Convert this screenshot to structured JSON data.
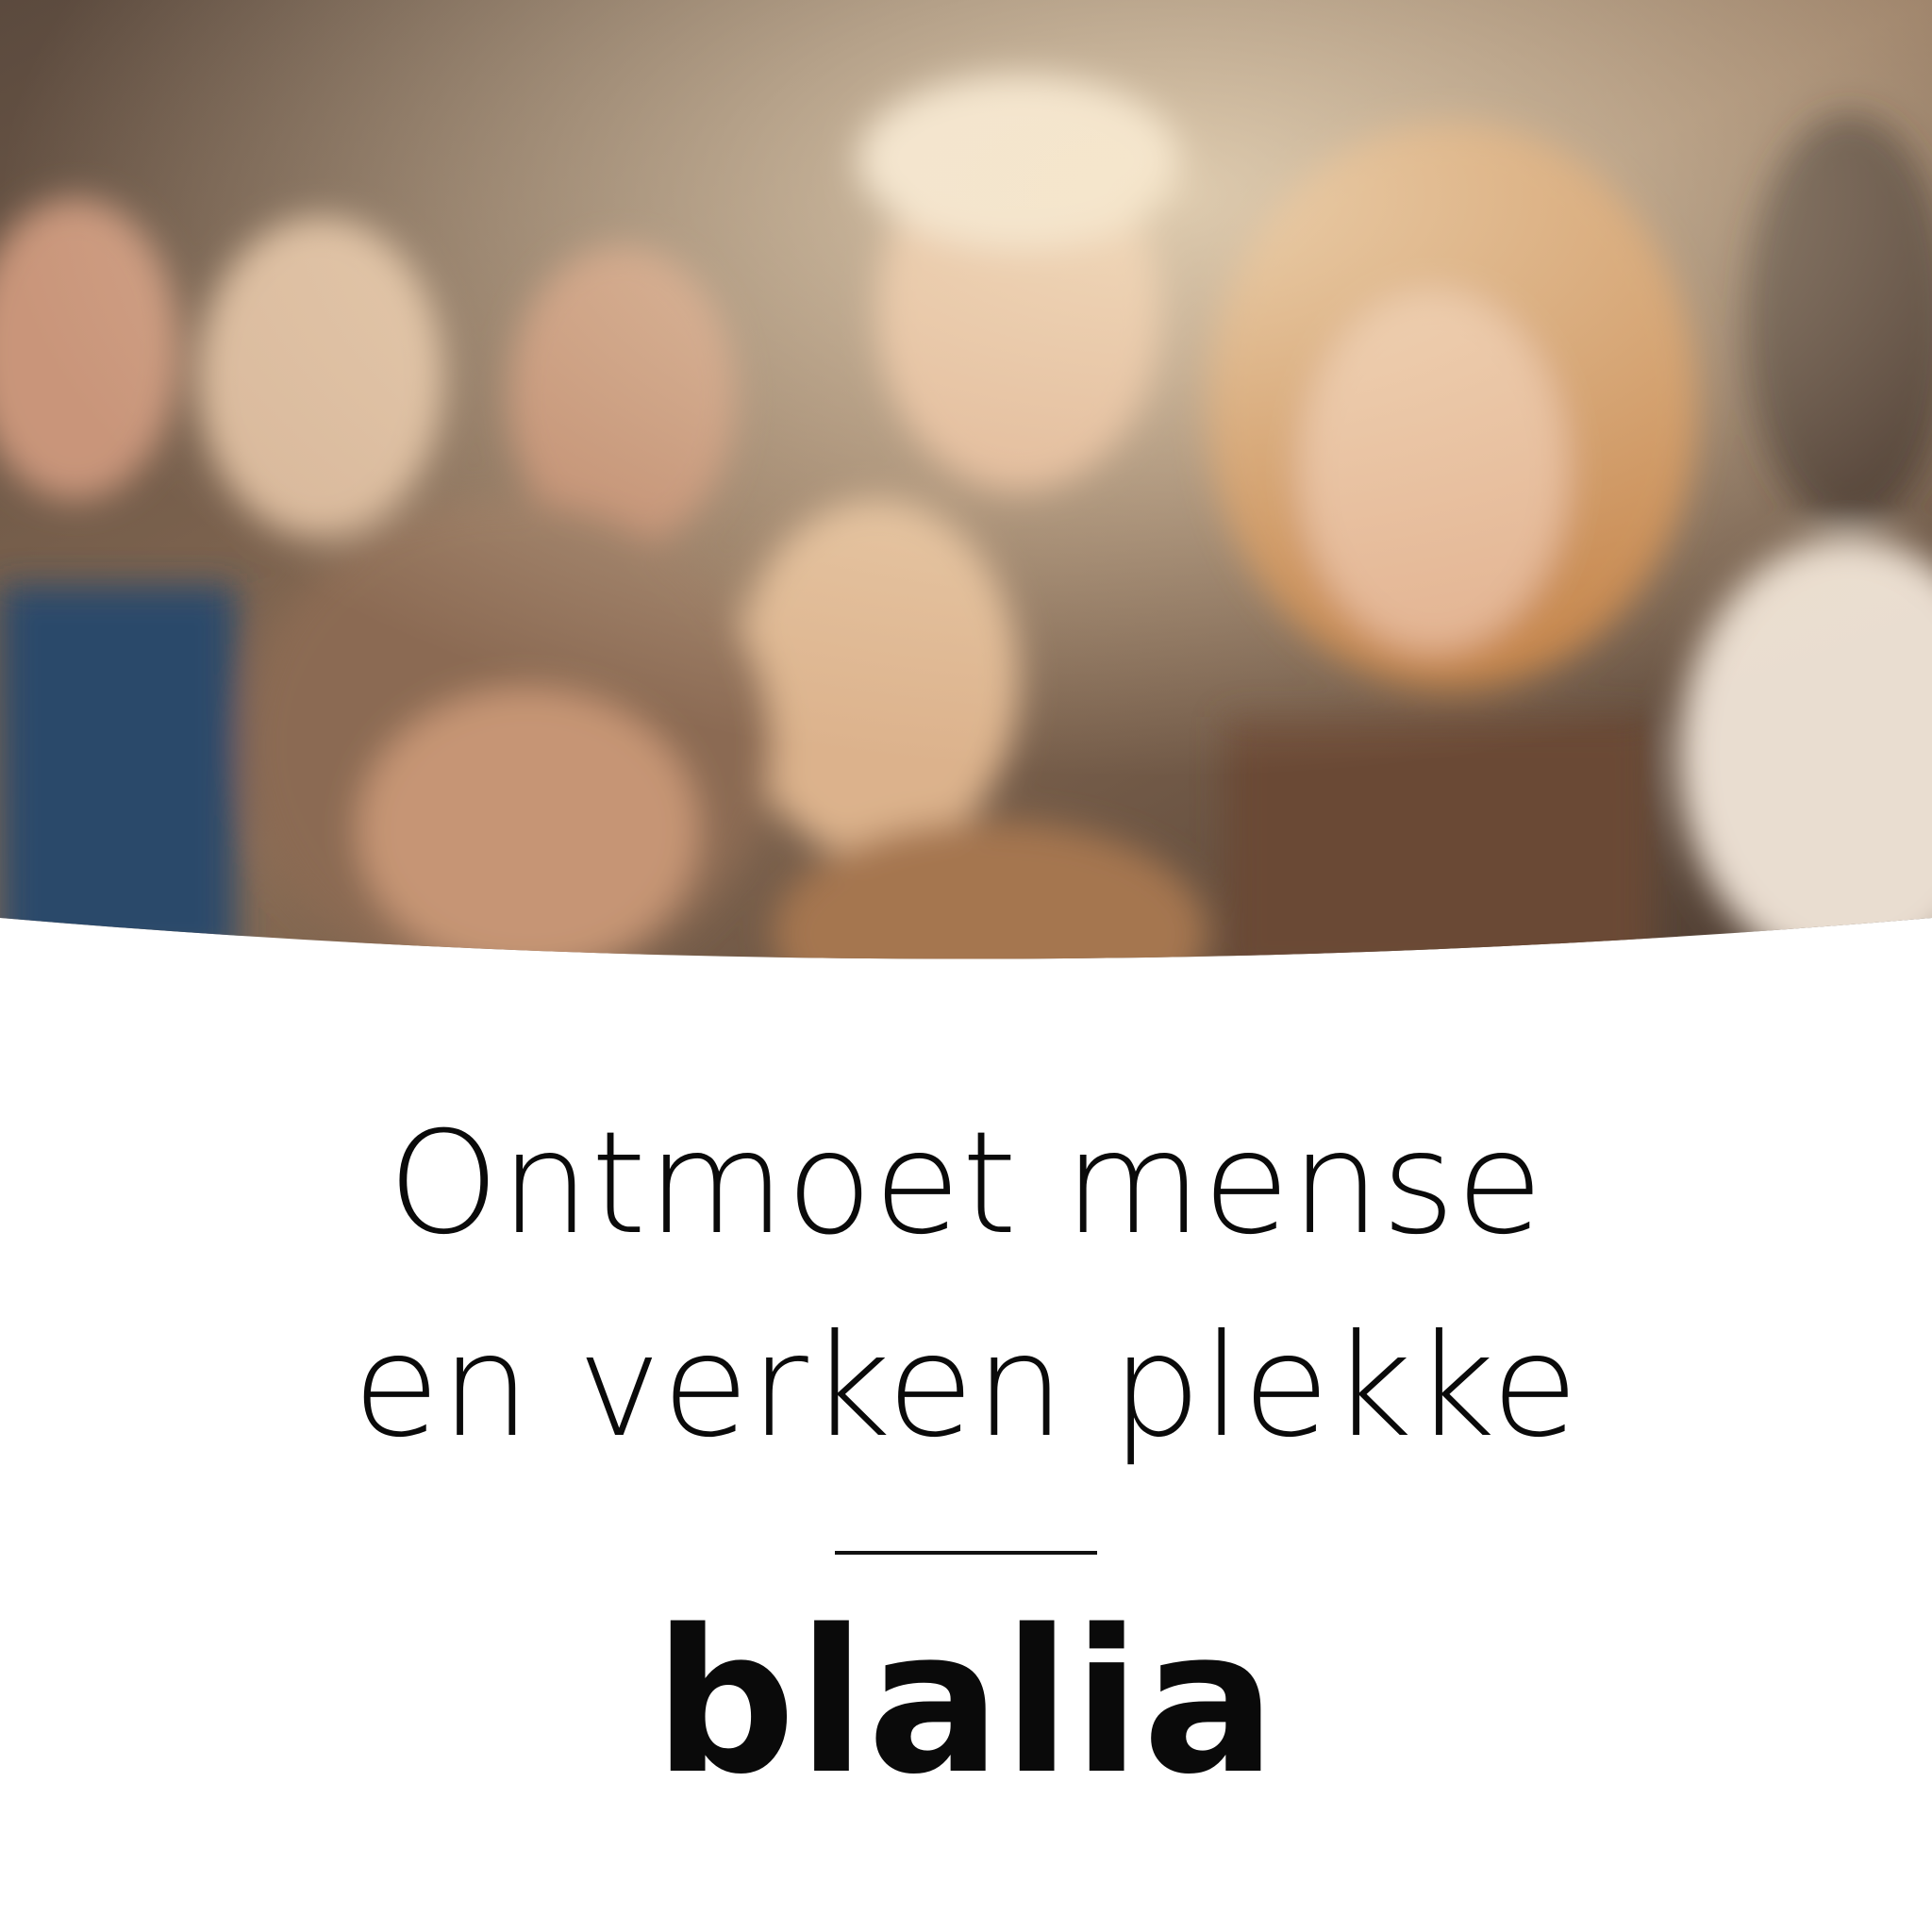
{
  "headline": {
    "line1": "Ontmoet mense",
    "line2": "en verken plekke"
  },
  "brand": {
    "logo": "blalia"
  },
  "colors": {
    "text": "#0a0a0a",
    "background": "#ffffff"
  }
}
